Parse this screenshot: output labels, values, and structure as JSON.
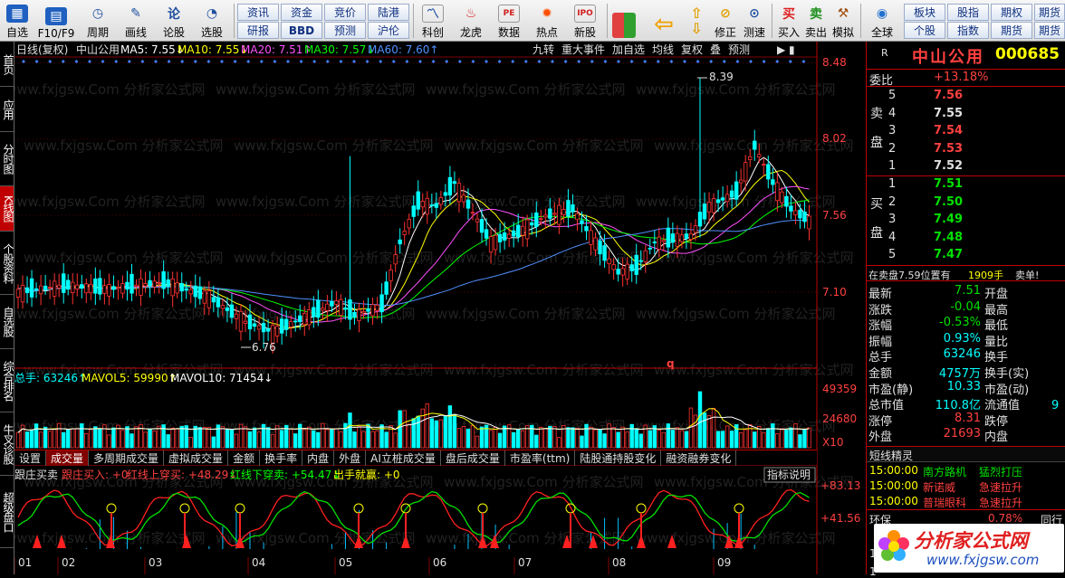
{
  "toolbar": {
    "items": [
      "自选",
      "F10/F9",
      "周期",
      "画线",
      "论股",
      "选股",
      "科创",
      "龙虎",
      "数据",
      "热点",
      "新股",
      "修正",
      "测速",
      "买入",
      "卖出",
      "模拟",
      "全球"
    ],
    "small_buttons": [
      [
        "资讯",
        "资金",
        "竞价",
        "陆港"
      ],
      [
        "研报",
        "BBD",
        "预测",
        "沪伦"
      ]
    ],
    "right_buttons": [
      [
        "板块",
        "股指",
        "期权",
        "期货"
      ],
      [
        "个股",
        "指数",
        "期货",
        "期货"
      ]
    ],
    "icon_marks": {
      "bujia": "买",
      "maichu": "卖"
    }
  },
  "left_tabs": [
    "首页",
    "应用",
    "分时图",
    "K线图",
    "个股资料",
    "自选股",
    "综合排名",
    "牛叉诊股",
    "超级盘口"
  ],
  "chart": {
    "header": {
      "mode": "日线(复权)",
      "name": "中山公用",
      "ma5": "MA5: 7.55↓",
      "ma10": "MA10: 7.55↓",
      "ma20": "MA20: 7.51↑",
      "ma30": "MA30: 7.57↓",
      "ma60": "MA60: 7.60↑"
    },
    "top_buttons": [
      "九转",
      "重大事件",
      "加自选",
      "均线",
      "复权",
      "叠",
      "预测"
    ],
    "price_labels": [
      "8.48",
      "8.02",
      "7.56",
      "7.10"
    ],
    "annotations": {
      "high": "8.39",
      "low": "6.76",
      "mark": "q"
    },
    "watermark": "www.fxjgsw.Com 分析家公式网",
    "vol_header": {
      "total": "总手: 63246↑",
      "mavol5": "MAVOL5: 59990↑",
      "mavol10": "MAVOL10: 71454↓"
    },
    "vol_labels": [
      "49359",
      "24680",
      "X10"
    ],
    "vol_tabs": [
      "设置",
      "成交量",
      "多周期成交量",
      "虚拟成交量",
      "金额",
      "换手率",
      "内盘",
      "外盘",
      "AI立桩成交量",
      "盘后成交量",
      "市盈率(ttm)",
      "陆股通持股变化",
      "融资融券变化"
    ],
    "ind_header": {
      "name": "跟庄买卖",
      "a": "跟庄买入: +0",
      "b": "红线上穿买: +48.29↓",
      "c": "红线下穿卖: +54.47↓",
      "d": "出手就赢: +0"
    },
    "ind_button": "指标说明",
    "ind_labels": [
      "+83.13",
      "+41.56"
    ],
    "months": [
      "01",
      "02",
      "03",
      "04",
      "05",
      "06",
      "07",
      "08",
      "09"
    ]
  },
  "quote": {
    "code_tag": "R",
    "name": "中山公用",
    "code": "000685",
    "weibi_label": "委比",
    "weibi": "+13.18%",
    "sell_label": "卖盘",
    "buy_label": "买盘",
    "sell": [
      [
        "5",
        "7.56"
      ],
      [
        "4",
        "7.55"
      ],
      [
        "3",
        "7.54"
      ],
      [
        "2",
        "7.53"
      ],
      [
        "1",
        "7.52"
      ]
    ],
    "buy": [
      [
        "1",
        "7.51"
      ],
      [
        "2",
        "7.50"
      ],
      [
        "3",
        "7.49"
      ],
      [
        "4",
        "7.48"
      ],
      [
        "5",
        "7.47"
      ]
    ],
    "notice": "在卖盘7.59位置有",
    "notice_vol": "1909手",
    "notice_tail": "卖单!",
    "stats": [
      [
        "最新",
        "7.51",
        "开盘"
      ],
      [
        "涨跌",
        "-0.04",
        "最高"
      ],
      [
        "涨幅",
        "-0.53%",
        "最低"
      ],
      [
        "振幅",
        "0.93%",
        "量比"
      ],
      [
        "总手",
        "63246",
        "换手"
      ],
      [
        "金额",
        "4757万",
        "换手(实)"
      ],
      [
        "市盈(静)",
        "10.33",
        "市盈(动)"
      ],
      [
        "总市值",
        "110.8亿",
        "流通值"
      ],
      [
        "涨停",
        "8.31",
        "跌停"
      ],
      [
        "外盘",
        "21693",
        "内盘"
      ]
    ],
    "stat_extra": "9",
    "spirit_title": "短线精灵",
    "spirit": [
      [
        "15:00:00",
        "南方路机",
        "猛烈打压"
      ],
      [
        "15:00:00",
        "新诺威",
        "急速拉升"
      ],
      [
        "15:00:00",
        "普瑞眼科",
        "急速拉升"
      ]
    ],
    "sector": "环保",
    "sector_pct": "0.78%",
    "sector_tail": "同行",
    "logo_text": "分析家公式网",
    "logo_url": "www.fxjgsw.com"
  },
  "colors": {
    "up": "#ff3232",
    "down": "#00ffff",
    "ma5": "#ffffff",
    "ma10": "#ffff00",
    "ma20": "#ff50ff",
    "ma30": "#00ff00",
    "ma60": "#5090ff"
  }
}
